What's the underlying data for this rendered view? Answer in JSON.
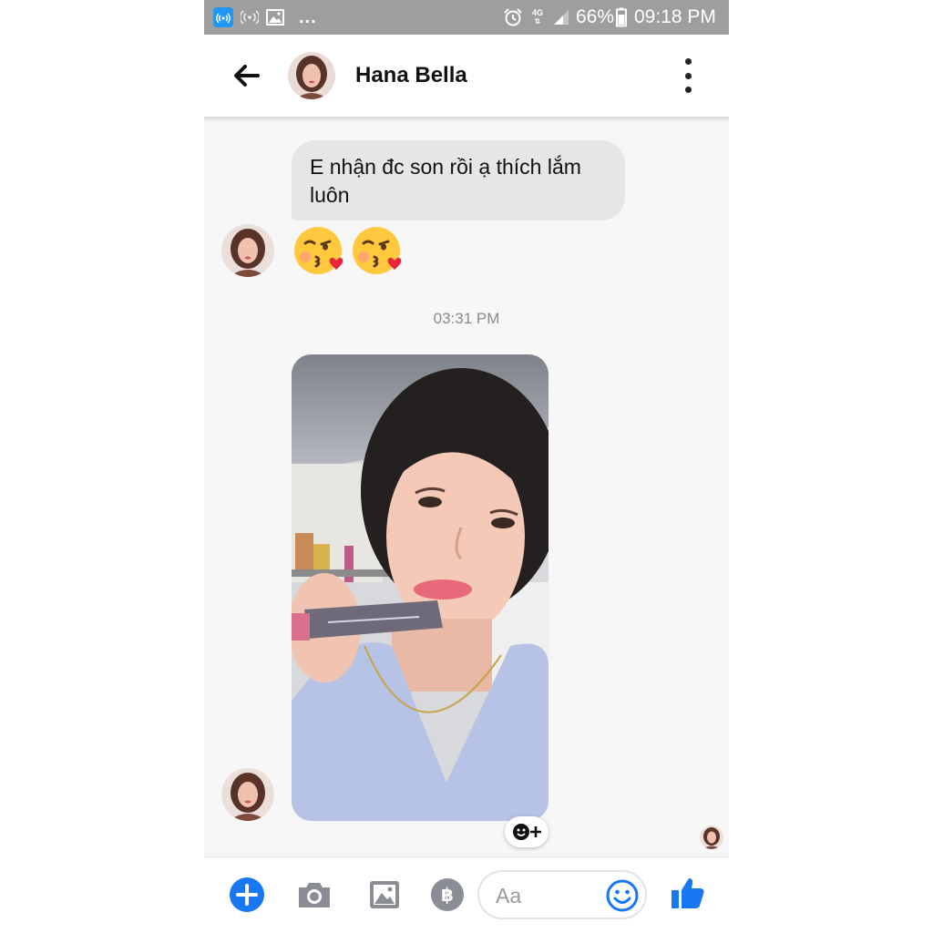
{
  "status_bar": {
    "network": "4G",
    "battery": "66%",
    "time": "09:18 PM",
    "overflow_indicator": "..."
  },
  "header": {
    "contact_name": "Hana Bella",
    "back_icon": "arrow-left-icon",
    "menu_icon": "more-vertical-icon"
  },
  "conversation": {
    "message_text": "E nhận đc son rồi ạ thích lắm luôn",
    "emojis": [
      "kissing-face-with-heart",
      "kissing-face-with-heart"
    ],
    "timestamp": "03:31 PM",
    "photo_description_icon": "photo-attachment",
    "react_icon": "add-reaction-icon"
  },
  "composer": {
    "placeholder": "Aa",
    "icons": [
      "plus-icon",
      "camera-icon",
      "gallery-icon",
      "payment-icon",
      "emoji-icon",
      "thumbs-up-icon"
    ]
  },
  "colors": {
    "accent": "#1877f2",
    "status_bar": "#9e9e9e",
    "bubble": "#e6e6e6",
    "background": "#f7f7f7"
  }
}
